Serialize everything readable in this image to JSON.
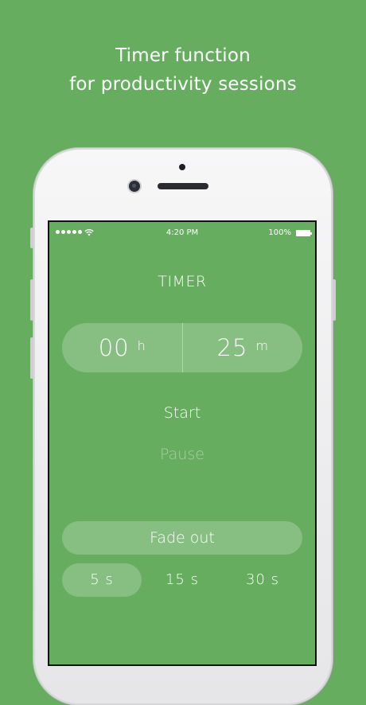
{
  "headline": {
    "line1": "Timer function",
    "line2": "for productivity sessions"
  },
  "status_bar": {
    "time": "4:20 PM",
    "battery": "100%"
  },
  "timer": {
    "title": "TIMER",
    "hours_value": "00",
    "hours_unit": "h",
    "minutes_value": "25",
    "minutes_unit": "m"
  },
  "controls": {
    "start_label": "Start",
    "pause_label": "Pause"
  },
  "fade": {
    "label": "Fade out",
    "options": [
      "5 s",
      "15 s",
      "30 s"
    ],
    "selected": "5 s"
  },
  "colors": {
    "background": "#66ad60",
    "text": "#ffffff"
  }
}
